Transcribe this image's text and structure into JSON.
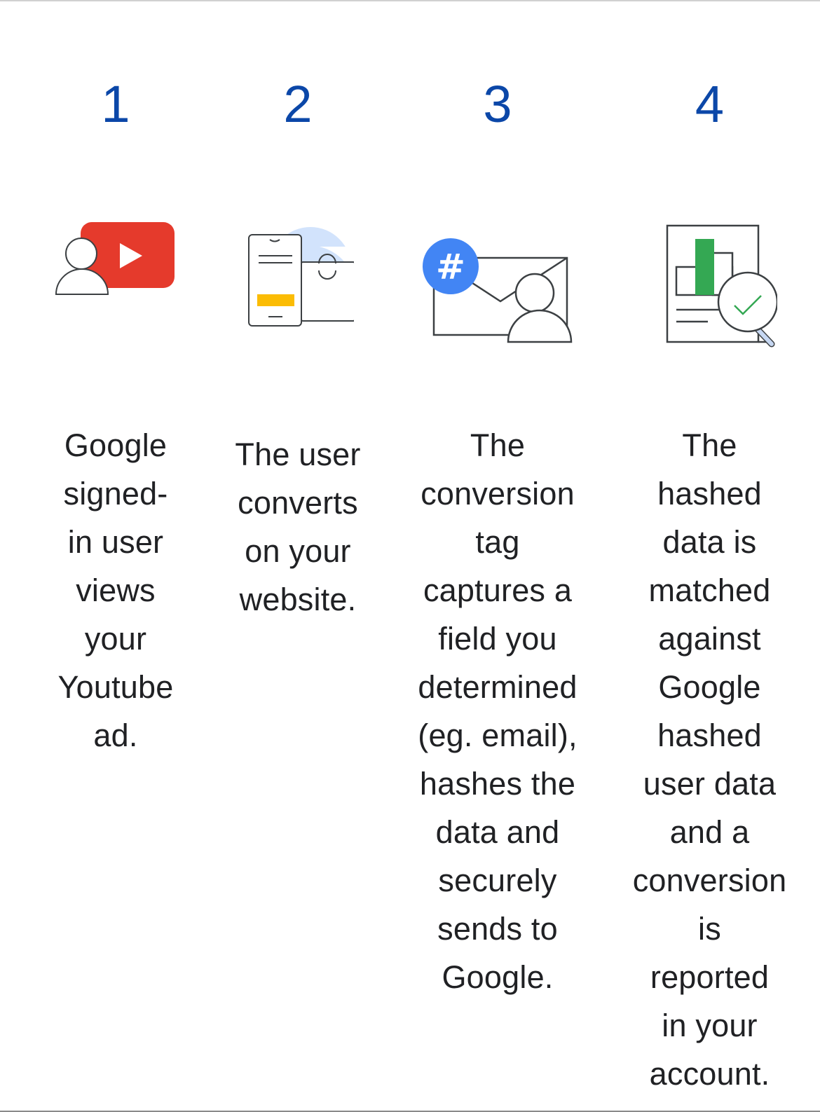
{
  "steps": [
    {
      "number": "1",
      "icon": "youtube-user-icon",
      "lines": [
        "Google",
        "signed-",
        "in user",
        "views",
        "your",
        "Youtube",
        "ad."
      ]
    },
    {
      "number": "2",
      "icon": "phone-shopping-bag-icon",
      "lines": [
        "The user",
        "converts",
        "on your",
        "website."
      ]
    },
    {
      "number": "3",
      "icon": "hashed-email-user-icon",
      "hash_symbol": "#",
      "lines": [
        "The",
        "conversion",
        "tag",
        "captures a",
        "field you",
        "determined",
        "(eg. email),",
        "hashes the",
        "data and",
        "securely",
        "sends to",
        "Google."
      ]
    },
    {
      "number": "4",
      "icon": "report-magnifier-check-icon",
      "lines": [
        "The",
        "hashed",
        "data is",
        "matched",
        "against",
        "Google",
        "hashed",
        "user data",
        "and a",
        "conversion",
        "is",
        "reported",
        "in your",
        "account."
      ]
    }
  ],
  "colors": {
    "number": "#0b47a8",
    "text": "#202124",
    "youtube_red": "#e53a2c",
    "hash_blue": "#4285f4",
    "bag_circle": "#d2e3fc",
    "button_yellow": "#fbbc04",
    "bar_green": "#34a853",
    "magnifier_handle": "#c6d7f2",
    "outline": "#3c4043"
  }
}
